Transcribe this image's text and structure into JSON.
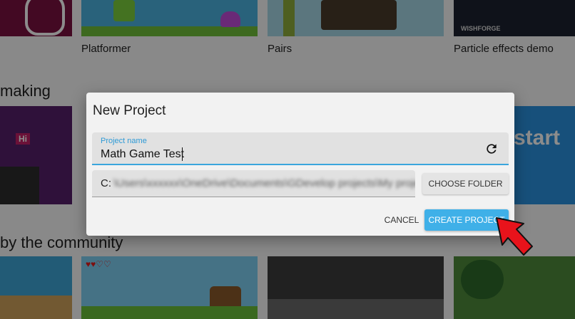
{
  "background": {
    "tiles_row1": [
      {
        "label": "Platformer"
      },
      {
        "label": "Pairs"
      },
      {
        "label": "Particle effects demo"
      }
    ],
    "section_making": "making",
    "section_community": "by the community",
    "start_text": "start",
    "hi_text": "Hi",
    "wishforge_text": "WISHFORGE"
  },
  "dialog": {
    "title": "New Project",
    "project_name_label": "Project name",
    "project_name_value": "Math Game Test",
    "folder_prefix": "C:",
    "choose_folder_label": "CHOOSE FOLDER",
    "cancel_label": "CANCEL",
    "create_label": "CREATE PROJECT"
  },
  "colors": {
    "accent": "#3fb0e8",
    "annotation_arrow": "#e8131b"
  },
  "icons": {
    "refresh": "refresh-icon",
    "arrow": "red-arrow-annotation"
  }
}
